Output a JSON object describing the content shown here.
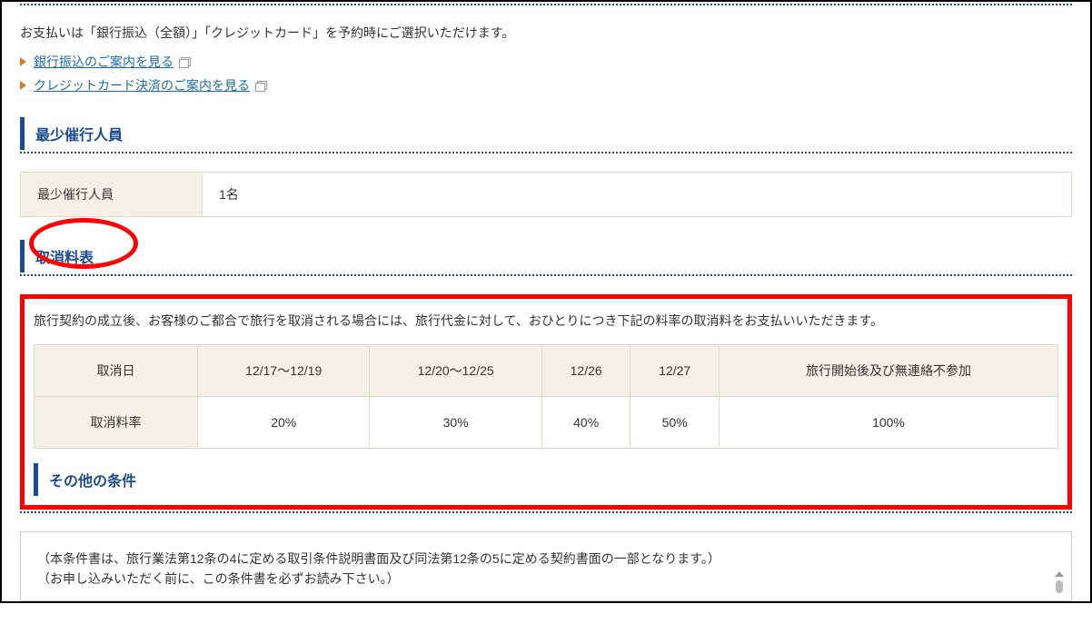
{
  "payment": {
    "intro": "お支払いは「銀行振込（全額）」「クレジットカード」を予約時にご選択いただけます。",
    "links": [
      "銀行振込のご案内を見る",
      "クレジットカード決済のご案内を見る"
    ]
  },
  "minParticipants": {
    "heading": "最少催行人員",
    "label": "最少催行人員",
    "value": "1名"
  },
  "cancellation": {
    "heading": "取消料表",
    "description": "旅行契約の成立後、お客様のご都合で旅行を取消される場合には、旅行代金に対して、おひとりにつき下記の料率の取消料をお支払いいただきます。",
    "table": {
      "row1_label": "取消日",
      "row2_label": "取消料率",
      "columns": [
        {
          "period": "12/17～12/19",
          "rate": "20%"
        },
        {
          "period": "12/20～12/25",
          "rate": "30%"
        },
        {
          "period": "12/26",
          "rate": "40%"
        },
        {
          "period": "12/27",
          "rate": "50%"
        },
        {
          "period": "旅行開始後及び無連絡不参加",
          "rate": "100%"
        }
      ]
    }
  },
  "otherConditions": {
    "heading": "その他の条件",
    "notes": [
      "（本条件書は、旅行業法第12条の4に定める取引条件説明書面及び同法第12条の5に定める契約書面の一部となります。）",
      "（お申し込みいただく前に、この条件書を必ずお読み下さい。）"
    ]
  }
}
